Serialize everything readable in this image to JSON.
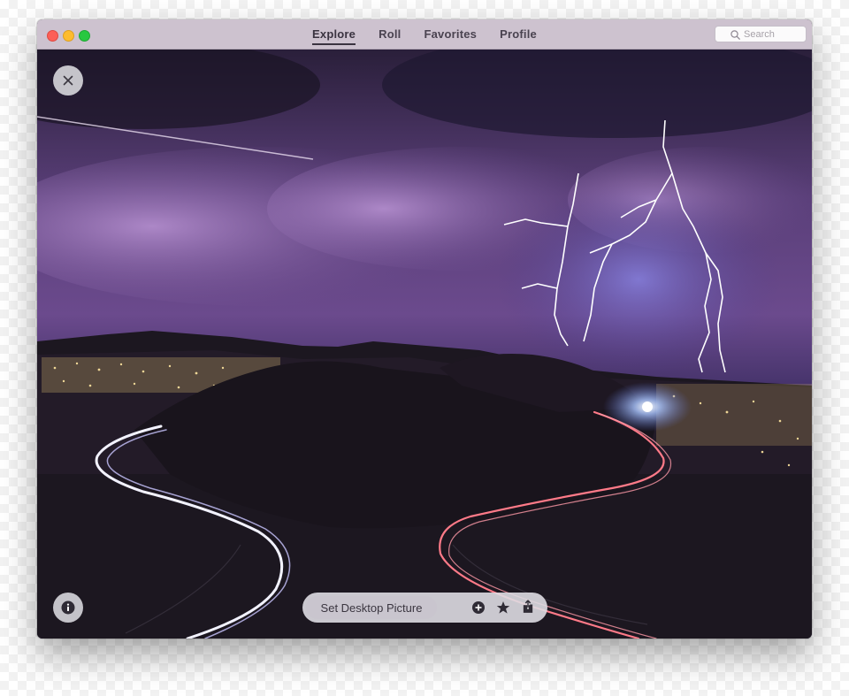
{
  "window": {
    "controls": [
      "close",
      "minimize",
      "zoom"
    ]
  },
  "nav": {
    "tabs": [
      {
        "label": "Explore",
        "active": true
      },
      {
        "label": "Roll",
        "active": false
      },
      {
        "label": "Favorites",
        "active": false
      },
      {
        "label": "Profile",
        "active": false
      }
    ]
  },
  "search": {
    "placeholder": "Search",
    "icon": "magnifier-icon"
  },
  "photo": {
    "subject": "lightning storm over winding night roads"
  },
  "overlay": {
    "close_icon": "close-icon",
    "info_icon": "info-icon"
  },
  "toolbar": {
    "set_desktop_label": "Set Desktop Picture",
    "icons": [
      "plus-icon",
      "star-icon",
      "share-icon"
    ]
  },
  "colors": {
    "titlebar": "#cdc2cf",
    "accent_text": "#3a3340",
    "overlay_button": "#dcdce0"
  }
}
